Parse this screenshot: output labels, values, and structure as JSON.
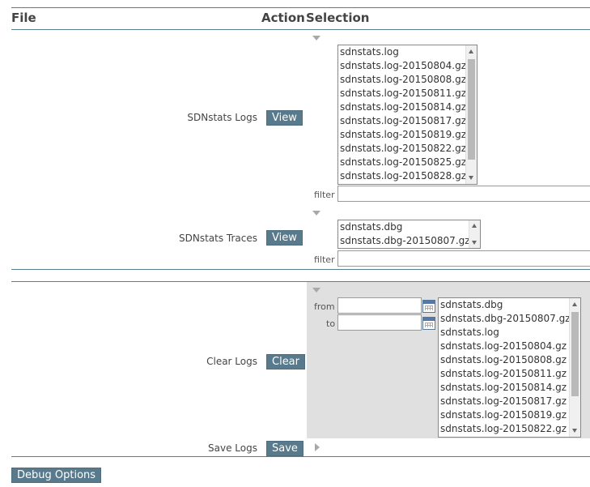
{
  "header": {
    "file": "File",
    "action": "Action",
    "selection": "Selection"
  },
  "sdnstats_logs": {
    "label": "SDNstats Logs",
    "button": "View",
    "files": [
      "sdnstats.log",
      "sdnstats.log-20150804.gz",
      "sdnstats.log-20150808.gz",
      "sdnstats.log-20150811.gz",
      "sdnstats.log-20150814.gz",
      "sdnstats.log-20150817.gz",
      "sdnstats.log-20150819.gz",
      "sdnstats.log-20150822.gz",
      "sdnstats.log-20150825.gz",
      "sdnstats.log-20150828.gz"
    ],
    "filter_label": "filter",
    "filter_value": ""
  },
  "sdnstats_traces": {
    "label": "SDNstats Traces",
    "button": "View",
    "files": [
      "sdnstats.dbg",
      "sdnstats.dbg-20150807.gz"
    ],
    "filter_label": "filter",
    "filter_value": ""
  },
  "clear_logs": {
    "label": "Clear Logs",
    "button": "Clear",
    "from_label": "from",
    "to_label": "to",
    "from_value": "",
    "to_value": "",
    "files": [
      "sdnstats.dbg",
      "sdnstats.dbg-20150807.gz",
      "sdnstats.log",
      "sdnstats.log-20150804.gz",
      "sdnstats.log-20150808.gz",
      "sdnstats.log-20150811.gz",
      "sdnstats.log-20150814.gz",
      "sdnstats.log-20150817.gz",
      "sdnstats.log-20150819.gz",
      "sdnstats.log-20150822.gz"
    ]
  },
  "save_logs": {
    "label": "Save Logs",
    "button": "Save"
  },
  "debug_options": {
    "label": "Debug Options"
  },
  "colors": {
    "accent": "#587a8c",
    "rule": "#5b7d8e",
    "panel": "#e0e0e0"
  }
}
